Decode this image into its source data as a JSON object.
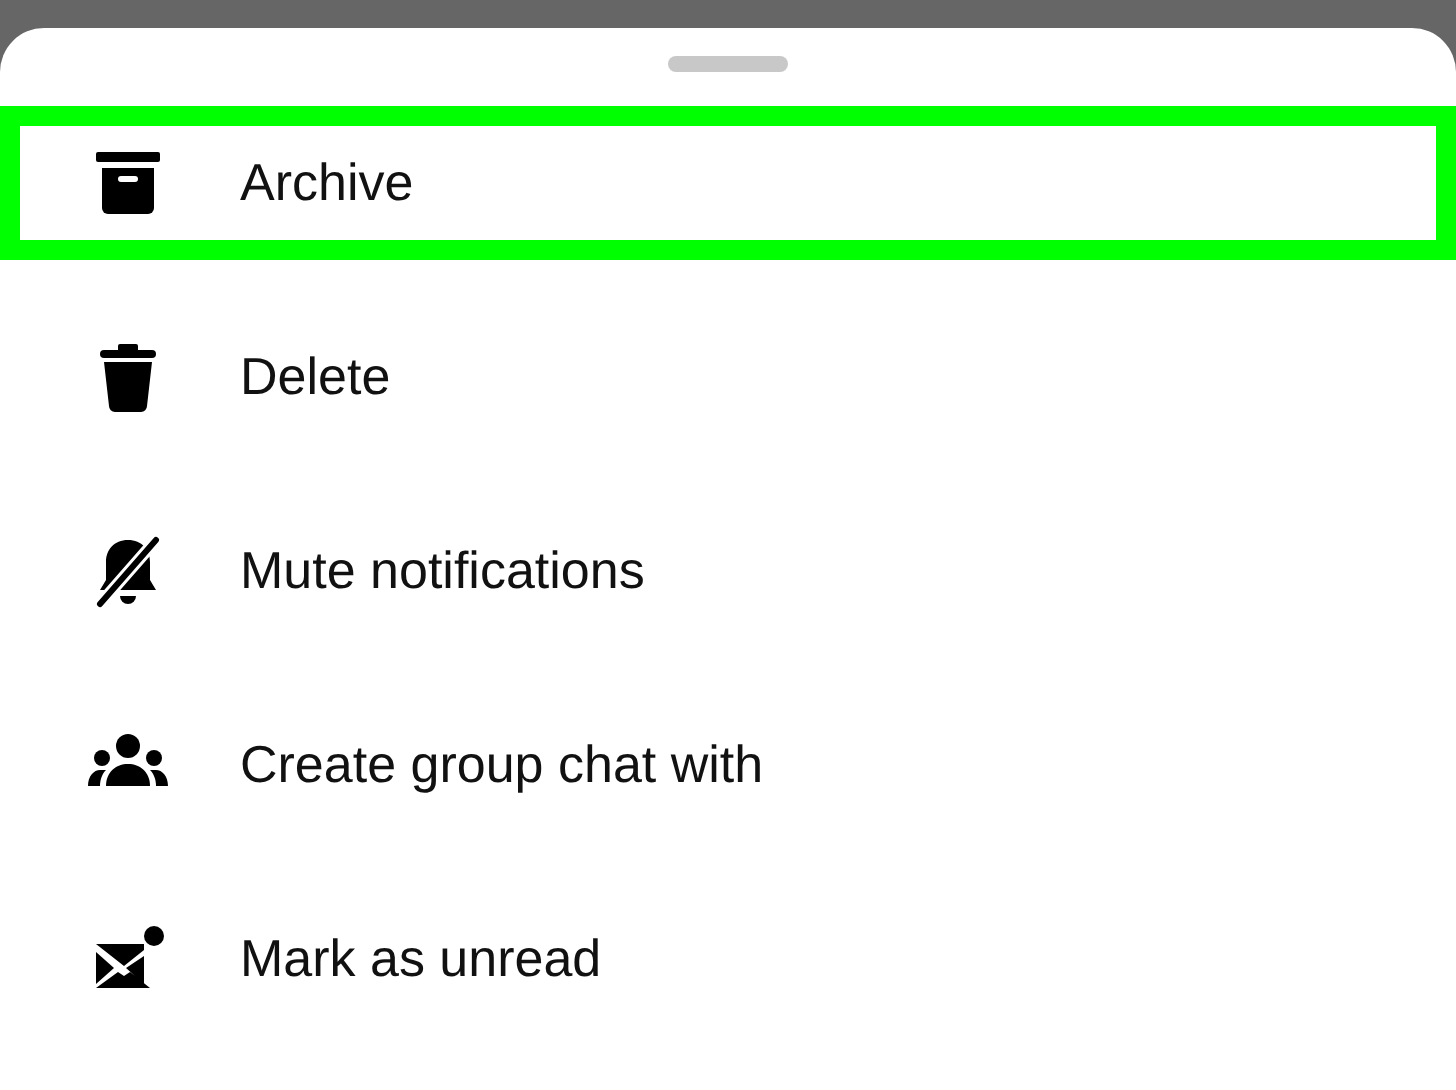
{
  "menu": {
    "items": [
      {
        "kind": "archive",
        "label": "Archive",
        "selected": true
      },
      {
        "kind": "delete",
        "label": "Delete",
        "selected": false
      },
      {
        "kind": "mute",
        "label": "Mute notifications",
        "selected": false
      },
      {
        "kind": "group",
        "label": "Create group chat with",
        "selected": false
      },
      {
        "kind": "unread",
        "label": "Mark as unread",
        "selected": false
      }
    ]
  }
}
